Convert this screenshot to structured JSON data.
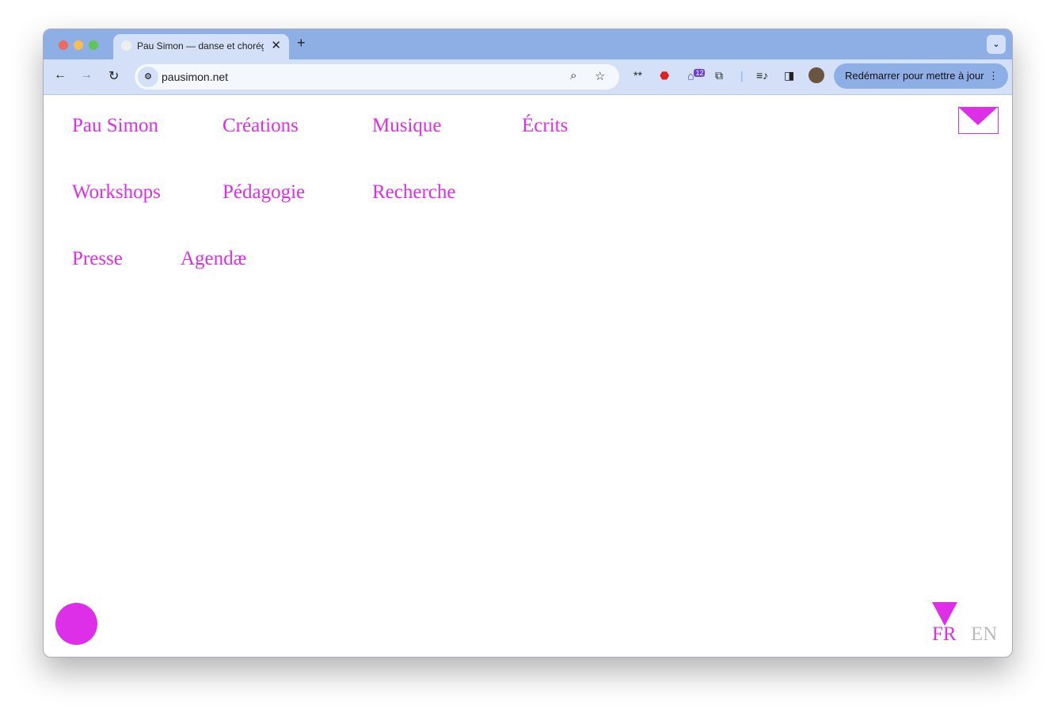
{
  "browser": {
    "tab_title": "Pau Simon — danse et chorégraphie",
    "url": "pausimon.net",
    "restart_label": "Redémarrer pour mettre à jour",
    "extension_badge": "12"
  },
  "nav": {
    "items": [
      "Pau Simon",
      "Créations",
      "Musique",
      "Écrits",
      "Workshops",
      "Pédagogie",
      "Recherche",
      "Presse",
      "Agendæ"
    ]
  },
  "languages": {
    "active": "FR",
    "other": "EN"
  },
  "colors": {
    "accent": "#dd2ee8",
    "inactive": "#bbbbbb"
  }
}
